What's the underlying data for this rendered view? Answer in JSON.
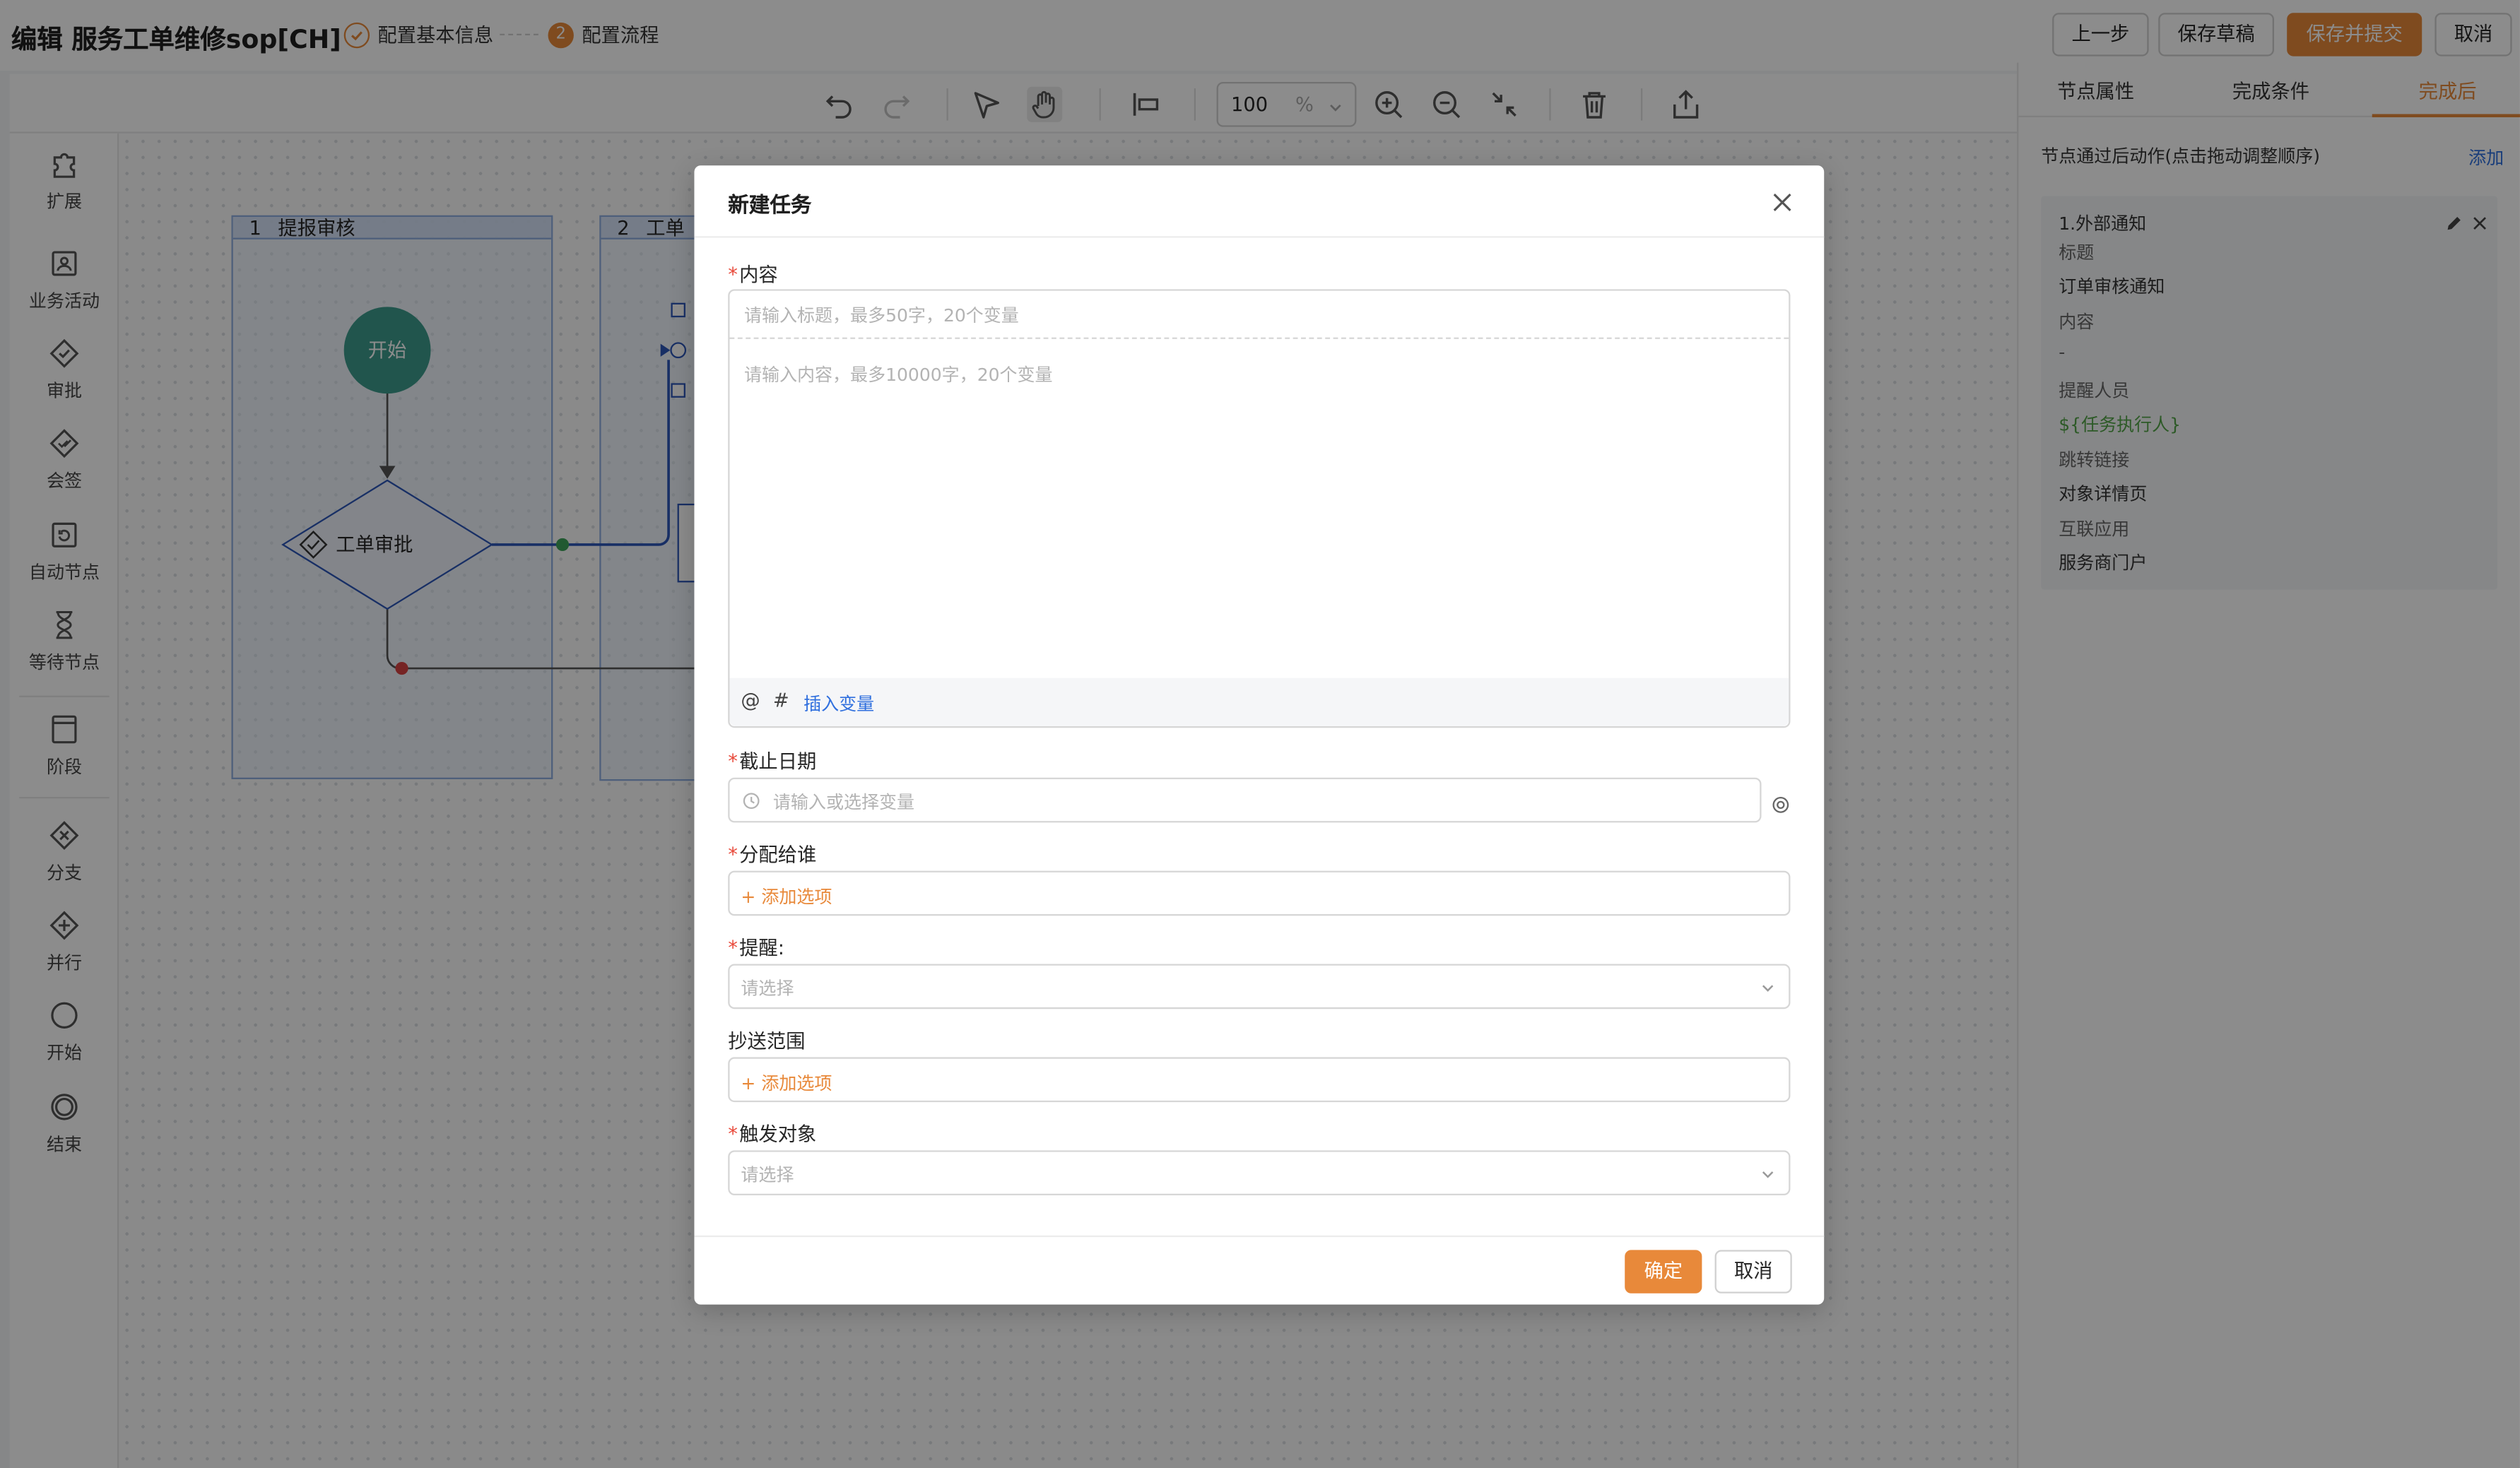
{
  "header": {
    "title": "编辑 服务工单维修sop[CH]",
    "steps": [
      {
        "index": "",
        "label": "配置基本信息"
      },
      {
        "index": "2",
        "label": "配置流程"
      }
    ],
    "buttons": {
      "prev": "上一步",
      "save_draft": "保存草稿",
      "save_submit": "保存并提交",
      "cancel": "取消"
    }
  },
  "toolbar": {
    "zoom_value": "100",
    "zoom_unit": "%"
  },
  "palette": [
    {
      "label": "扩展",
      "icon": "puzzle-icon"
    },
    {
      "label": "业务活动",
      "icon": "business-activity-icon"
    },
    {
      "label": "审批",
      "icon": "approval-icon"
    },
    {
      "label": "会签",
      "icon": "countersign-icon"
    },
    {
      "label": "自动节点",
      "icon": "auto-node-icon"
    },
    {
      "label": "等待节点",
      "icon": "hourglass-icon"
    },
    {
      "label": "阶段",
      "icon": "stage-icon"
    },
    {
      "label": "分支",
      "icon": "branch-icon"
    },
    {
      "label": "并行",
      "icon": "parallel-icon"
    },
    {
      "label": "开始",
      "icon": "start-circle-icon"
    },
    {
      "label": "结束",
      "icon": "end-circle-icon"
    }
  ],
  "canvas": {
    "lanes": [
      {
        "num": "1",
        "title": "提报审核"
      },
      {
        "num": "2",
        "title": "工单"
      }
    ],
    "start_label": "开始",
    "approval_label": "工单审批"
  },
  "right_panel": {
    "tabs": [
      "节点属性",
      "完成条件",
      "完成后"
    ],
    "active_tab": "完成后",
    "hint": "节点通过后动作(点击拖动调整顺序)",
    "add": "添加",
    "card": {
      "name": "1.外部通知",
      "lines": [
        {
          "text": "标题",
          "style": "gray"
        },
        {
          "text": "订单审核通知",
          "style": "normal"
        },
        {
          "text": "内容",
          "style": "gray"
        },
        {
          "text": "-",
          "style": "gray"
        },
        {
          "text": "提醒人员",
          "style": "gray"
        },
        {
          "text": "${任务执行人}",
          "style": "green"
        },
        {
          "text": "跳转链接",
          "style": "gray"
        },
        {
          "text": "对象详情页",
          "style": "normal"
        },
        {
          "text": "互联应用",
          "style": "gray"
        },
        {
          "text": "服务商门户",
          "style": "normal"
        }
      ]
    }
  },
  "modal": {
    "title": "新建任务",
    "content": {
      "label": "内容",
      "title_placeholder": "请输入标题，最多50字，20个变量",
      "body_placeholder": "请输入内容，最多10000字，20个变量",
      "at": "@",
      "hash": "#",
      "insert_var": "插入变量"
    },
    "deadline": {
      "label": "截止日期",
      "placeholder": "请输入或选择变量"
    },
    "assignee": {
      "label": "分配给谁",
      "add": "+ 添加选项"
    },
    "remind": {
      "label": "提醒:",
      "placeholder": "请选择"
    },
    "cc": {
      "label": "抄送范围",
      "add": "+ 添加选项"
    },
    "trigger": {
      "label": "触发对象",
      "placeholder": "请选择"
    },
    "buttons": {
      "ok": "确定",
      "cancel": "取消"
    }
  },
  "colors": {
    "accent": "#e8893a",
    "link": "#2f6fde",
    "required": "#e8493a",
    "start_node": "#3d9c8c",
    "variable": "#52a447"
  }
}
